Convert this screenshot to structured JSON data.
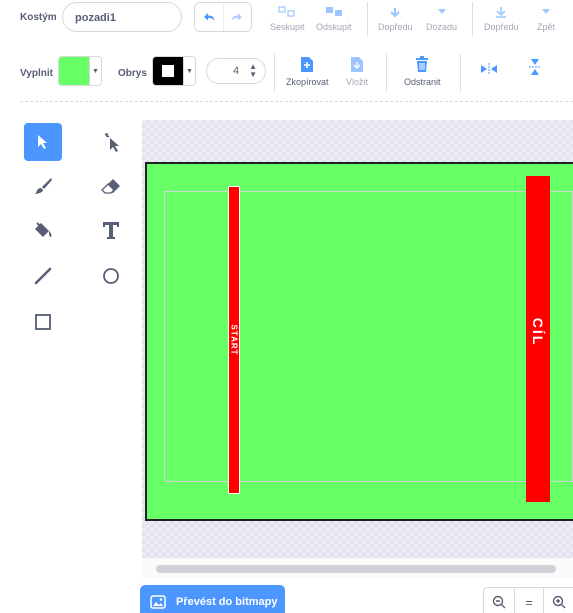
{
  "costume": {
    "label": "Kostým",
    "name": "pozadi1"
  },
  "toolbar": {
    "group_label": "Seskupit",
    "ungroup_label": "Odskupit",
    "forward_label": "Dopředu",
    "backward_label": "Dozadu",
    "front_label": "Dopředu",
    "back_label": "Zpět",
    "copy_label": "Zkopírovat",
    "paste_label": "Vložit",
    "delete_label": "Odstranit"
  },
  "style": {
    "fill_label": "Vyplnit",
    "outline_label": "Obrys",
    "fill_color": "#66ff66",
    "outline_color": "#000000",
    "stroke_width": "4"
  },
  "canvas": {
    "backdrop_color": "#66ff66",
    "bar_color": "#ff0000",
    "start_text": "START",
    "finish_text": "CÍL"
  },
  "bottom": {
    "convert_label": "Převést do bitmapy",
    "zoom_reset_label": "="
  }
}
